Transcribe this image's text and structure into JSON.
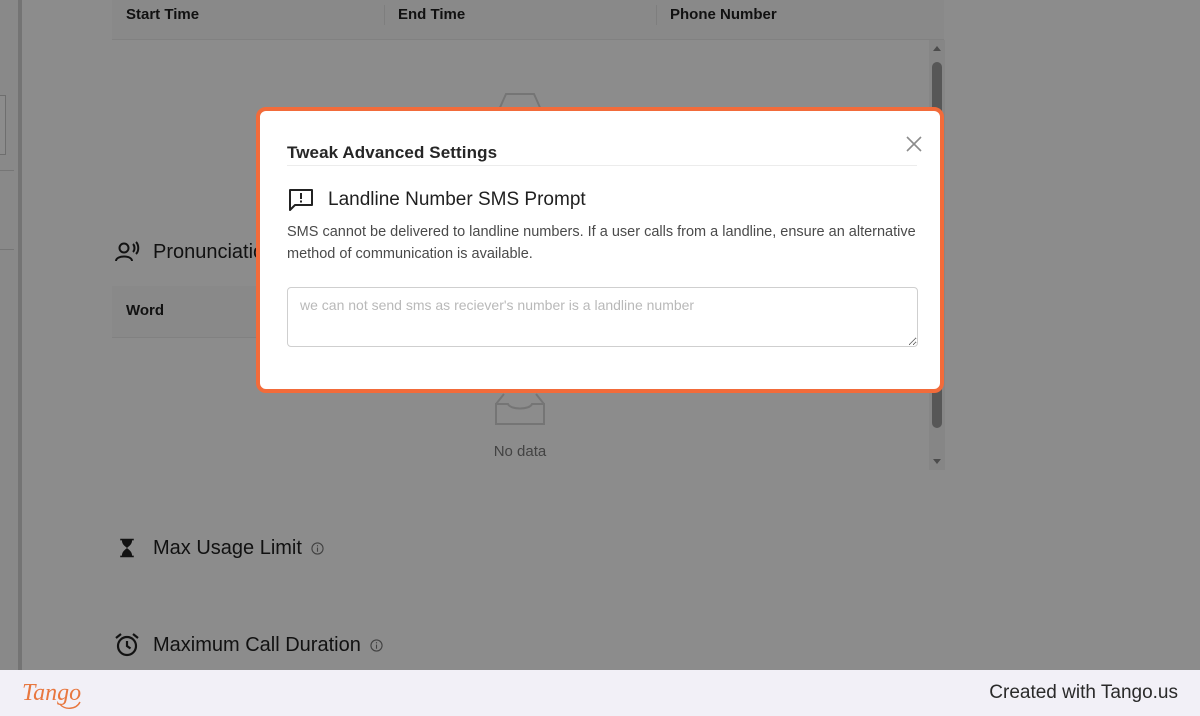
{
  "background": {
    "table1": {
      "columns": [
        "Start Time",
        "End Time",
        "Phone Number"
      ]
    },
    "table2": {
      "columns": [
        "Word"
      ]
    },
    "empty_text": "No data",
    "sections": {
      "pronunciation": "Pronunciatio",
      "max_usage": "Max Usage Limit",
      "max_duration": "Maximum Call Duration"
    }
  },
  "modal": {
    "title": "Tweak Advanced Settings",
    "prompt_title": "Landline Number SMS Prompt",
    "prompt_description": "SMS cannot be delivered to landline numbers. If a user calls from a landline, ensure an alternative method of communication is available.",
    "textarea_placeholder": "we can not send sms as reciever's number is a landline number",
    "textarea_value": ""
  },
  "footer": {
    "logo_text": "Tango",
    "credit": "Created with Tango.us"
  },
  "colors": {
    "modal_border": "#f26b3a",
    "tango_brand": "#e8773f",
    "overlay": "rgba(0,0,0,0.45)"
  },
  "icons": {
    "close": "close-icon",
    "prompt": "message-alert-icon",
    "pronunciation": "voice-user-icon",
    "usage": "hourglass-icon",
    "duration": "alarm-clock-icon",
    "info": "info-icon"
  }
}
